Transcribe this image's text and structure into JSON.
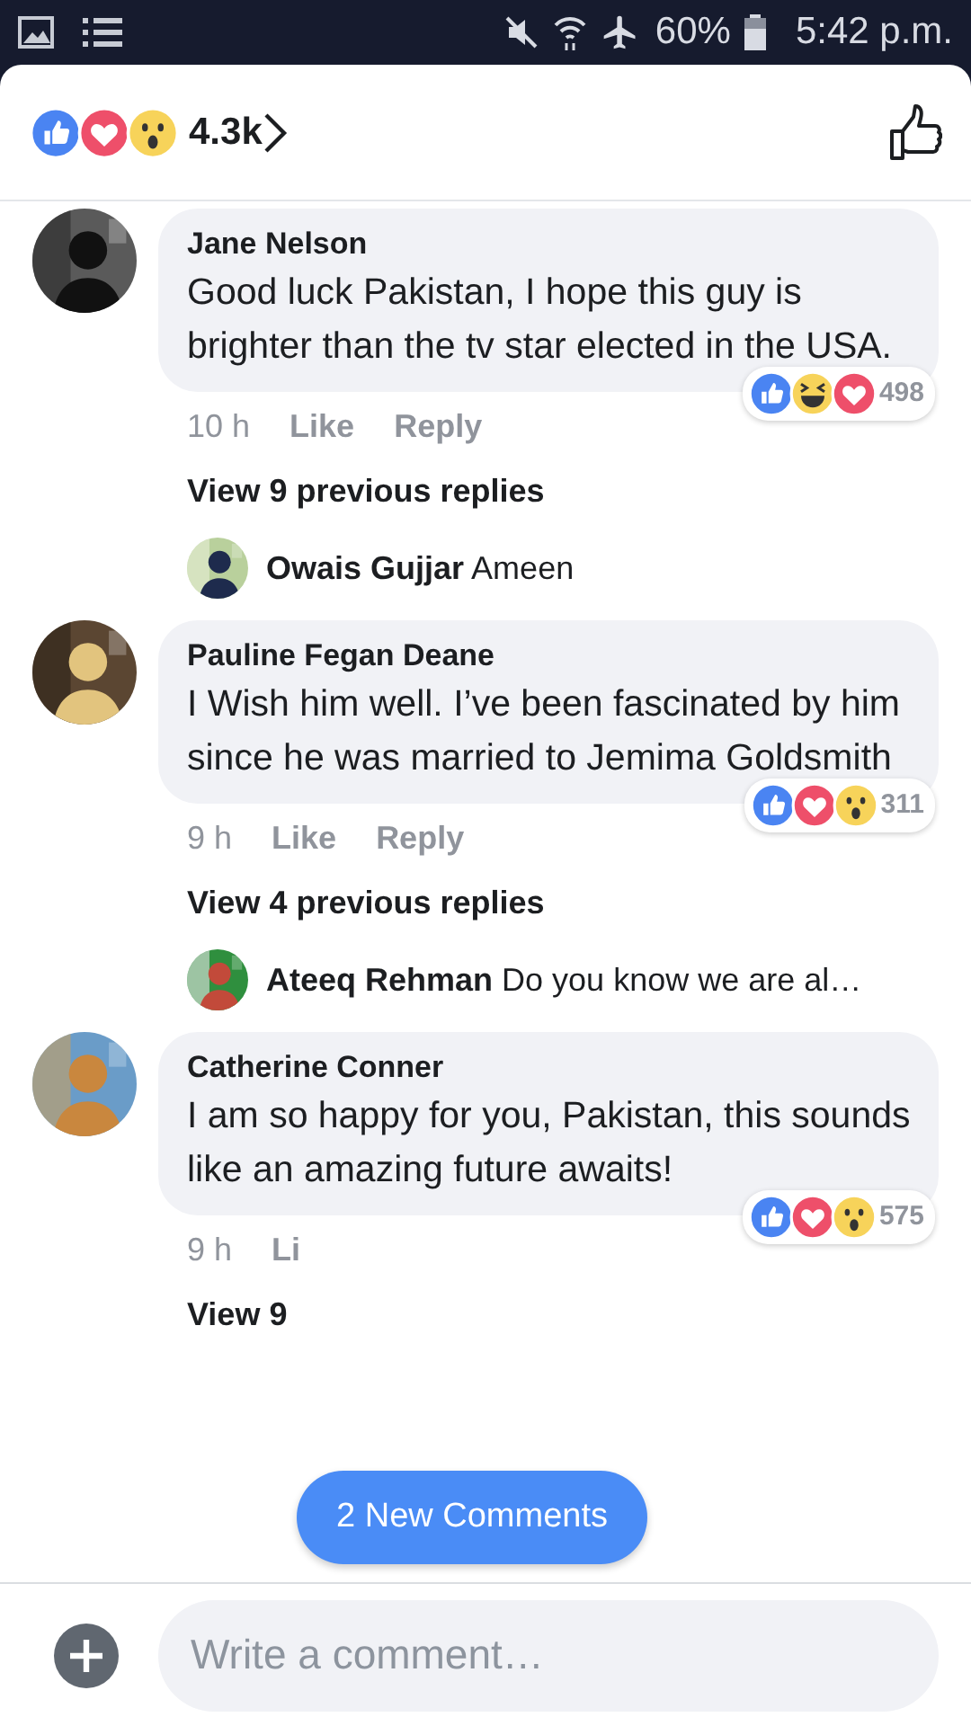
{
  "status_bar": {
    "battery": "60%",
    "time": "5:42 p.m."
  },
  "header": {
    "reactions": [
      {
        "kind": "like"
      },
      {
        "kind": "love"
      },
      {
        "kind": "wow"
      }
    ],
    "count": "4.3k"
  },
  "comments": [
    {
      "name": "Jane Nelson",
      "text": "Good luck Pakistan,  I hope this guy is brighter than the tv star elected in the USA.",
      "time": "10 h",
      "actions": [
        "Like",
        "Reply"
      ],
      "reactions": [
        {
          "kind": "like"
        },
        {
          "kind": "haha"
        },
        {
          "kind": "love"
        }
      ],
      "reaction_count": "498",
      "view_replies": "View 9 previous replies",
      "reply": {
        "name": "Owais Gujjar",
        "text": "Ameen"
      }
    },
    {
      "name": "Pauline Fegan Deane",
      "text": "I Wish him well. I’ve been fascinated by him since he was married to Jemima Goldsmith",
      "time": "9 h",
      "actions": [
        "Like",
        "Reply"
      ],
      "reactions": [
        {
          "kind": "like"
        },
        {
          "kind": "love"
        },
        {
          "kind": "wow"
        }
      ],
      "reaction_count": "311",
      "view_replies": "View 4 previous replies",
      "reply": {
        "name": "Ateeq Rehman",
        "text": "Do you know we are al…"
      }
    },
    {
      "name": "Catherine Conner",
      "text": "I am so happy for you, Pakistan, this sounds like an amazing future awaits!",
      "time": "9 h",
      "actions": [
        "Li"
      ],
      "reactions": [
        {
          "kind": "like"
        },
        {
          "kind": "love"
        },
        {
          "kind": "wow"
        }
      ],
      "reaction_count": "575",
      "view_replies": "View 9"
    }
  ],
  "new_comments_pill": "2 New Comments",
  "composer": {
    "placeholder": "Write a comment…"
  }
}
